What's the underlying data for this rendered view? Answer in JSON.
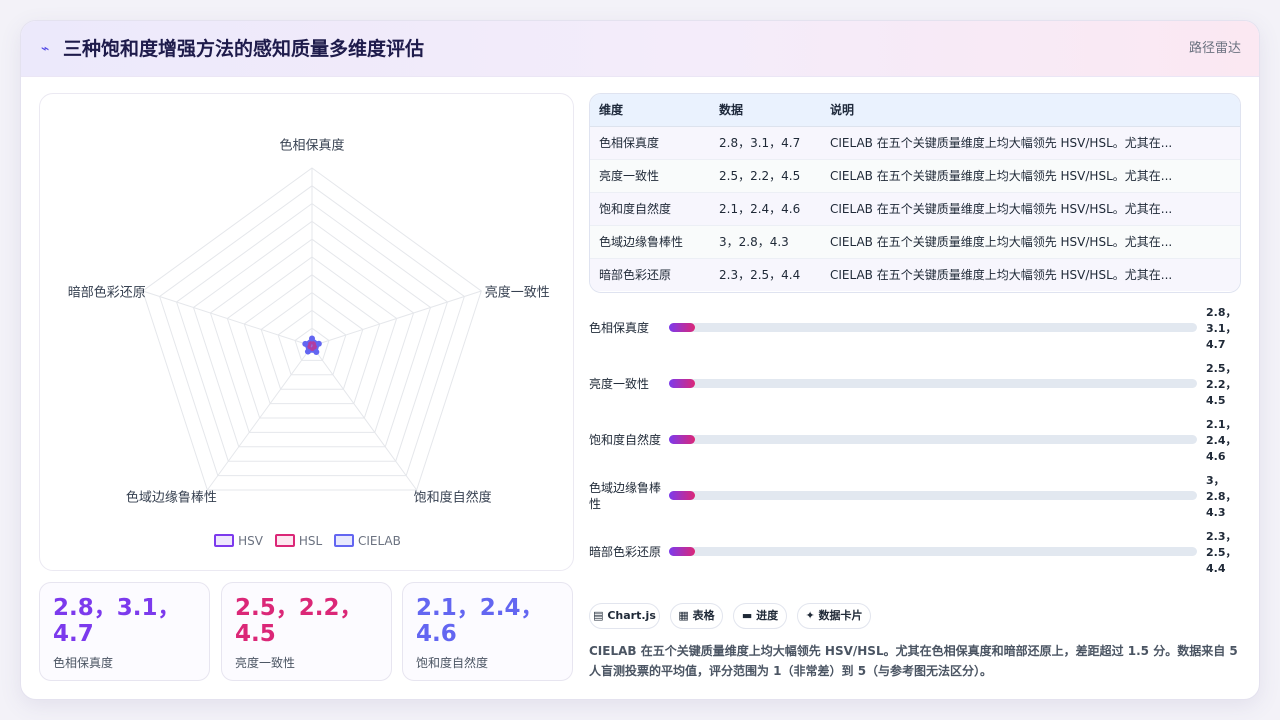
{
  "header": {
    "title": "三种饱和度增强方法的感知质量多维度评估",
    "tag": "路径雷达"
  },
  "colors": {
    "hsv": "#7c3aed",
    "hsl": "#db2777",
    "cielab": "#6366f1"
  },
  "chart_data": {
    "type": "radar",
    "axes": [
      "色相保真度",
      "亮度一致性",
      "饱和度自然度",
      "色域边缘鲁棒性",
      "暗部色彩还原"
    ],
    "range": [
      0,
      5
    ],
    "series": [
      {
        "name": "HSV",
        "values": [
          2.8,
          2.5,
          2.1,
          3,
          2.3
        ]
      },
      {
        "name": "HSL",
        "values": [
          3.1,
          2.2,
          2.4,
          2.8,
          2.5
        ]
      },
      {
        "name": "CIELAB",
        "values": [
          4.7,
          4.5,
          4.6,
          4.3,
          4.4
        ]
      }
    ],
    "legend": [
      "HSV",
      "HSL",
      "CIELAB"
    ]
  },
  "stats": [
    {
      "value": "2.8，3.1，4.7",
      "label": "色相保真度"
    },
    {
      "value": "2.5，2.2，4.5",
      "label": "亮度一致性"
    },
    {
      "value": "2.1，2.4，4.6",
      "label": "饱和度自然度"
    }
  ],
  "table": {
    "headers": [
      "维度",
      "数据",
      "说明"
    ],
    "rows": [
      [
        "色相保真度",
        "2.8，3.1，4.7",
        "CIELAB 在五个关键质量维度上均大幅领先 HSV/HSL。尤其在..."
      ],
      [
        "亮度一致性",
        "2.5，2.2，4.5",
        "CIELAB 在五个关键质量维度上均大幅领先 HSV/HSL。尤其在..."
      ],
      [
        "饱和度自然度",
        "2.1，2.4，4.6",
        "CIELAB 在五个关键质量维度上均大幅领先 HSV/HSL。尤其在..."
      ],
      [
        "色域边缘鲁棒性",
        "3，2.8，4.3",
        "CIELAB 在五个关键质量维度上均大幅领先 HSV/HSL。尤其在..."
      ],
      [
        "暗部色彩还原",
        "2.3，2.5，4.4",
        "CIELAB 在五个关键质量维度上均大幅领先 HSV/HSL。尤其在..."
      ]
    ]
  },
  "bars": [
    {
      "label": "色相保真度",
      "value": "2.8，3.1，4.7",
      "fill": 0.05
    },
    {
      "label": "亮度一致性",
      "value": "2.5，2.2，4.5",
      "fill": 0.05
    },
    {
      "label": "饱和度自然度",
      "value": "2.1，2.4，4.6",
      "fill": 0.05
    },
    {
      "label": "色域边缘鲁棒性",
      "value": "3，2.8，4.3",
      "fill": 0.05
    },
    {
      "label": "暗部色彩还原",
      "value": "2.3，2.5，4.4",
      "fill": 0.05
    }
  ],
  "chips": [
    {
      "icon": "▤",
      "label": "Chart.js"
    },
    {
      "icon": "▦",
      "label": "表格"
    },
    {
      "icon": "▬",
      "label": "进度"
    },
    {
      "icon": "✦",
      "label": "数据卡片"
    }
  ],
  "summary": "CIELAB 在五个关键质量维度上均大幅领先 HSV/HSL。尤其在色相保真度和暗部还原上，差距超过 1.5 分。数据来自 5 人盲测投票的平均值，评分范围为 1（非常差）到 5（与参考图无法区分）。"
}
